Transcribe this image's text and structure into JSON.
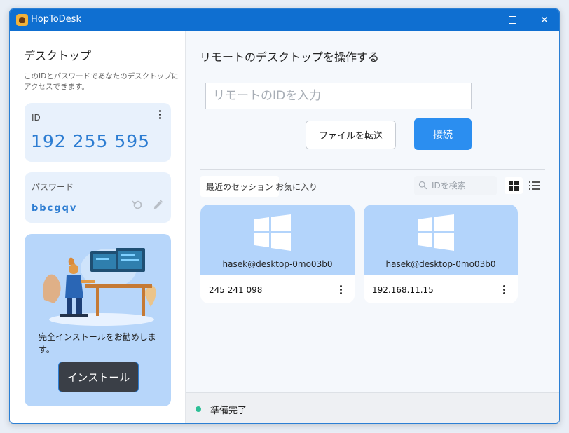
{
  "window": {
    "title": "HopToDesk"
  },
  "sidebar": {
    "title": "デスクトップ",
    "description": "このIDとパスワードであなたのデスクトップにアクセスできます。",
    "id_card": {
      "label": "ID",
      "value": "192 255 595"
    },
    "password_card": {
      "label": "パスワード",
      "value": "bbcgqv"
    },
    "promo": {
      "text": "完全インストールをお勧めします。",
      "install_label": "インストール"
    }
  },
  "main": {
    "title": "リモートのデスクトップを操作する",
    "remote_id_placeholder": "リモートのIDを入力",
    "transfer_label": "ファイルを転送",
    "connect_label": "接続",
    "tabs": [
      {
        "label": "最近のセッション",
        "active": true
      },
      {
        "label": "お気に入り",
        "active": false
      }
    ],
    "search_placeholder": "IDを検索",
    "sessions": [
      {
        "host": "hasek@desktop-0mo03b0",
        "address": "245 241 098",
        "icon": "windows-icon"
      },
      {
        "host": "hasek@desktop-0mo03b0",
        "address": "192.168.11.15",
        "icon": "windows-icon"
      }
    ]
  },
  "status": {
    "text": "準備完了",
    "color": "#2cbf96"
  },
  "colors": {
    "accent": "#2b8ef0",
    "titlebar": "#0f6fd1",
    "card_top": "#b3d4fb",
    "id_text": "#2d7dd2"
  }
}
